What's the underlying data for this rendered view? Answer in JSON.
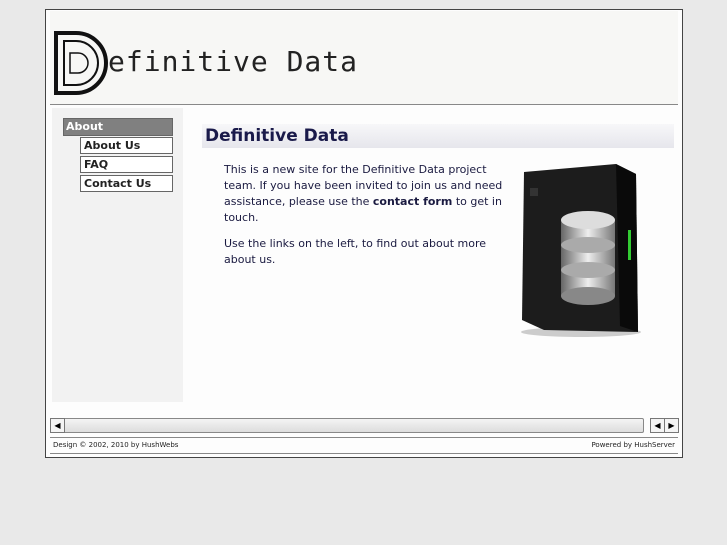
{
  "header": {
    "logo_text": "efinitive Data"
  },
  "sidebar": {
    "section": "About",
    "items": [
      {
        "label": "About Us"
      },
      {
        "label": "FAQ"
      },
      {
        "label": "Contact Us"
      }
    ]
  },
  "main": {
    "title": "Definitive Data",
    "para1_a": "This is a new site for the Definitive Data project team. If you have been invited to join us and need assistance, please use the ",
    "para1_link": "contact form",
    "para1_b": " to get in touch.",
    "para2": "Use the links on the left, to find out about more about us."
  },
  "footer": {
    "left": "Design © 2002, 2010 by HushWebs",
    "right": "Powered by HushServer"
  }
}
